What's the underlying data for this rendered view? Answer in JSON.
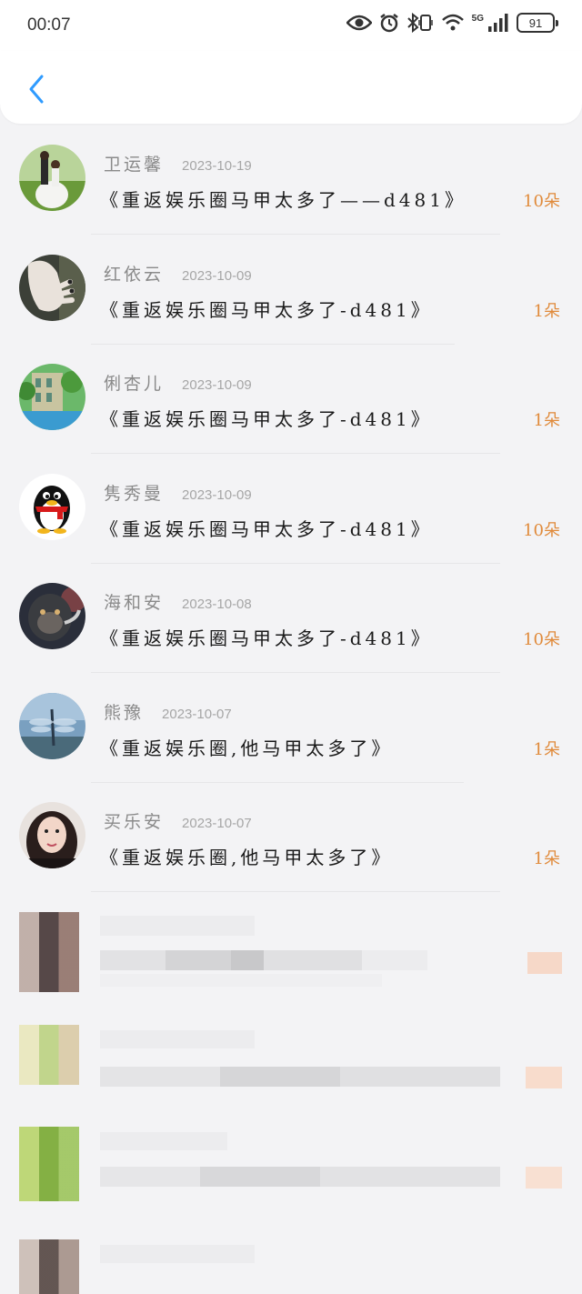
{
  "status_bar": {
    "time": "00:07",
    "network": "5G",
    "battery": "91",
    "icons": [
      "eye-icon",
      "alarm-icon",
      "bluetooth-vibrate-icon",
      "wifi-icon",
      "signal-icon",
      "battery-icon"
    ]
  },
  "nav": {
    "back_icon": "chevron-left-icon"
  },
  "colors": {
    "accent": "#2f9bff",
    "count": "#e08a3a",
    "name": "#8a8a8a",
    "date": "#a6a6a6"
  },
  "gifts": [
    {
      "name": "卫运馨",
      "date": "2023-10-19",
      "gift": "《重返娱乐圈马甲太多了——d481》",
      "count": "10朵",
      "avatar": "wedding-photo-avatar"
    },
    {
      "name": "红依云",
      "date": "2023-10-09",
      "gift": "《重返娱乐圈马甲太多了-d481》",
      "count": "1朵",
      "avatar": "hand-photo-avatar"
    },
    {
      "name": "俐杏儿",
      "date": "2023-10-09",
      "gift": "《重返娱乐圈马甲太多了-d481》",
      "count": "1朵",
      "avatar": "castle-photo-avatar"
    },
    {
      "name": "隽秀曼",
      "date": "2023-10-09",
      "gift": "《重返娱乐圈马甲太多了-d481》",
      "count": "10朵",
      "avatar": "penguin-avatar"
    },
    {
      "name": "海和安",
      "date": "2023-10-08",
      "gift": "《重返娱乐圈马甲太多了-d481》",
      "count": "10朵",
      "avatar": "gorilla-photo-avatar"
    },
    {
      "name": "熊豫",
      "date": "2023-10-07",
      "gift": "《重返娱乐圈,他马甲太多了》",
      "count": "1朵",
      "avatar": "dragonfly-photo-avatar"
    },
    {
      "name": "买乐安",
      "date": "2023-10-07",
      "gift": "《重返娱乐圈,他马甲太多了》",
      "count": "1朵",
      "avatar": "woman-portrait-avatar"
    }
  ]
}
